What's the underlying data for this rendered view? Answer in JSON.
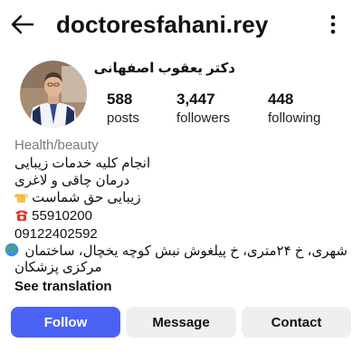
{
  "header": {
    "username": "doctoresfahani.rey",
    "back_icon": "arrow-left-icon",
    "more_icon": "vertical-dots-icon"
  },
  "profile": {
    "display_name": "دکتر یعقوب اصفهانی",
    "avatar": "profile-photo",
    "stats": {
      "posts": {
        "value": "588",
        "label": "posts"
      },
      "followers": {
        "value": "3,447",
        "label": "followers"
      },
      "following": {
        "value": "448",
        "label": "following"
      }
    },
    "category": "Health/beauty",
    "bio": {
      "line1": "انجام کلیه خدمات زیبایی",
      "line2": "درمان چاقی و لاغری",
      "line3": "زیبایی حق شماست",
      "line4": "55910200",
      "line5": "09122402592",
      "line6": "شهری، خ ۲۴متری، خ پیلغوش نبش کوچه یخچال، ساختمان",
      "line7": "مرکزی پزشکان"
    },
    "see_translation": "See translation"
  },
  "actions": {
    "follow": "Follow",
    "message": "Message",
    "contact": "Contact"
  },
  "colors": {
    "accent": "#4a63f5",
    "secondary_button": "#efefef",
    "category_text": "#7a7a7a"
  }
}
